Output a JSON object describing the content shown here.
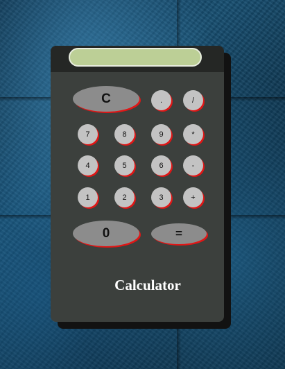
{
  "app": {
    "title": "Calculator"
  },
  "display": {
    "value": ""
  },
  "keys": {
    "clear": "C",
    "dot": ".",
    "divide": "/",
    "seven": "7",
    "eight": "8",
    "nine": "9",
    "multiply": "*",
    "four": "4",
    "five": "5",
    "six": "6",
    "minus": "-",
    "one": "1",
    "two": "2",
    "three": "3",
    "plus": "+",
    "zero": "0",
    "equals": "="
  },
  "colors": {
    "body": "#3c403d",
    "top_bar": "#252725",
    "display": "#bccf96",
    "key_shadow": "#e01616",
    "small_key": "#c3c3c3",
    "big_key": "#8c8c8c"
  }
}
